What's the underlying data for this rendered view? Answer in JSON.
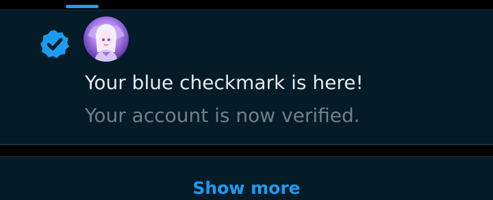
{
  "notification": {
    "title": "Your blue checkmark is here!",
    "subtitle": "Your account is now verified.",
    "badge_icon": "verified-badge-icon",
    "avatar_icon": "user-avatar",
    "accent_color": "#1d9bf0"
  },
  "footer": {
    "show_more_label": "Show more"
  }
}
